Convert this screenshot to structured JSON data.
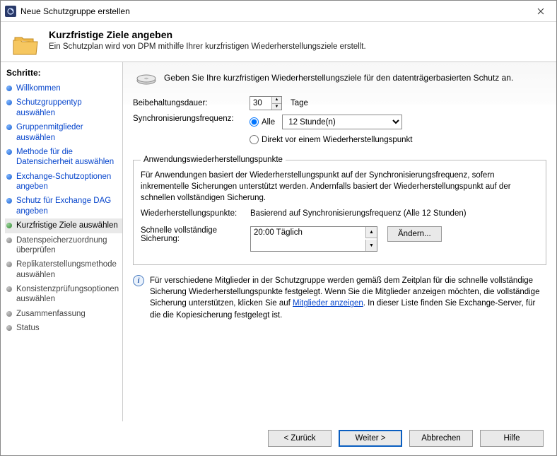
{
  "window": {
    "title": "Neue Schutzgruppe erstellen"
  },
  "header": {
    "heading": "Kurzfristige Ziele angeben",
    "subheading": "Ein Schutzplan wird von DPM mithilfe Ihrer kurzfristigen Wiederherstellungsziele erstellt."
  },
  "sidebar": {
    "title": "Schritte:",
    "steps": [
      {
        "label": "Willkommen"
      },
      {
        "label": "Schutzgruppentyp auswählen"
      },
      {
        "label": "Gruppenmitglieder auswählen"
      },
      {
        "label": "Methode für die Datensicherheit auswählen"
      },
      {
        "label": "Exchange-Schutzoptionen angeben"
      },
      {
        "label": "Schutz für Exchange DAG angeben"
      },
      {
        "label": "Kurzfristige Ziele auswählen"
      },
      {
        "label": "Datenspeicherzuordnung überprüfen"
      },
      {
        "label": "Replikaterstellungsmethode auswählen"
      },
      {
        "label": "Konsistenzprüfungsoptionen auswählen"
      },
      {
        "label": "Zusammenfassung"
      },
      {
        "label": "Status"
      }
    ]
  },
  "main": {
    "intro": "Geben Sie Ihre kurzfristigen Wiederherstellungsziele für den datenträgerbasierten Schutz an.",
    "retention": {
      "label": "Beibehaltungsdauer:",
      "value": "30",
      "unit": "Tage"
    },
    "sync": {
      "label": "Synchronisierungsfrequenz:",
      "opt_all": "Alle",
      "combo": "12 Stunde(n)",
      "opt_before": "Direkt vor einem Wiederherstellungspunkt"
    },
    "fieldset": {
      "legend": "Anwendungswiederherstellungspunkte",
      "desc": "Für Anwendungen basiert der Wiederherstellungspunkt auf der Synchronisierungsfrequenz, sofern inkrementelle Sicherungen unterstützt werden. Andernfalls basiert der Wiederherstellungspunkt auf der schnellen vollständigen Sicherung.",
      "recovery_label": "Wiederherstellungspunkte:",
      "recovery_value": "Basierend auf Synchronisierungsfrequenz (Alle 12 Stunden)",
      "fullbackup_label": "Schnelle vollständige Sicherung:",
      "fullbackup_value": "20:00 Täglich",
      "modify_btn": "Ändern..."
    },
    "info": {
      "text_before": "Für verschiedene Mitglieder in der Schutzgruppe werden gemäß dem Zeitplan für die schnelle vollständige Sicherung Wiederherstellungspunkte festgelegt. Wenn Sie die Mitglieder anzeigen möchten, die vollständige Sicherung unterstützen, klicken Sie auf ",
      "link": "Mitglieder anzeigen",
      "text_after": ". In dieser Liste finden Sie Exchange-Server, für die die Kopiesicherung festgelegt ist."
    }
  },
  "footer": {
    "back": "< Zurück",
    "next": "Weiter >",
    "cancel": "Abbrechen",
    "help": "Hilfe"
  }
}
